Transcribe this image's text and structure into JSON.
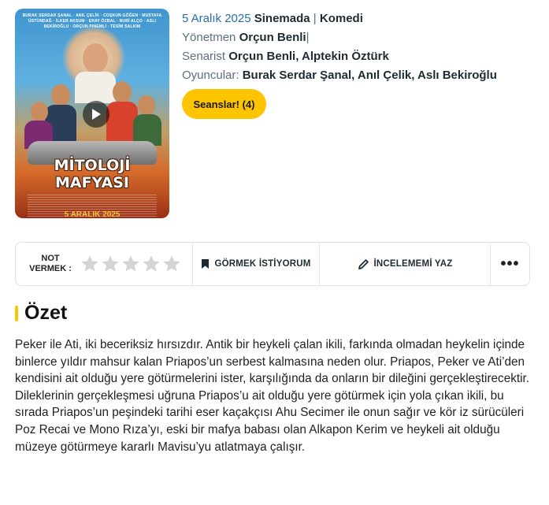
{
  "poster": {
    "cast_line": "BURAK SERDAR ŞANAL · ANIL ÇELİK · COŞKUN GÖĞEN · MUSTAFA ÜSTÜNDAĞ · İLKER AKSUM · ERAY ÖZBAL · NURİ ALÇO · ASLI BEKİROĞLU · ORÇUN PINEMLİ · TESİM SALKIM",
    "title_line1": "MİTOLOJİ",
    "title_line2": "MAFYASI",
    "date": "5 ARALIK 2025"
  },
  "meta": {
    "date": "5 Aralık 2025",
    "release": "Sinemada",
    "separator": "|",
    "genre": "Komedi",
    "director_label": "Yönetmen",
    "director": "Orçun Benli",
    "director_sep": "|",
    "writer_label": "Senarist",
    "writers": "Orçun Benli, Alptekin Öztürk",
    "cast_label": "Oyuncular:",
    "cast": "Burak Serdar Şanal, Anıl Çelik, Aslı Bekiroğlu"
  },
  "showtimes_button": "Seanslar! (4)",
  "actionbar": {
    "rate_label_line1": "NOT",
    "rate_label_line2": "VERMEK :",
    "star_count": 5,
    "rating_value": 0,
    "watchlist_label": "GÖRMEK İSTİYORUM",
    "review_label": "İNCELEMEMİ YAZ",
    "more_label": "•••"
  },
  "summary": {
    "title": "Özet",
    "text": "Peker ile Ati, iki beceriksiz hırsızdır. Antik bir heykeli çalan ikili, farkında olmadan heykelin içinde binlerce yıldır mahsur kalan Priapos’un serbest kalmasına neden olur. Priapos, Peker ve Ati’den kendisini ait olduğu yere götürmelerini ister, karşılığında da onların bir dileğini gerçekleştirecektir. Dileklerinin gerçekleşmesi uğruna Priapos’u ait olduğu yere götürmek için yola çıkan ikili, bu sırada Priapos’un peşindeki tarihi eser kaçakçısı Ahu Secimer ile onun sağır ve kör iz sürücüleri Poz Recai ve Mono Rıza’yı, eski bir mafya babası olan Alkapon Kerim ve heykeli ait olduğu müzeye götürmeye kararlı Mavisu’yu atlatmaya çalışır."
  },
  "colors": {
    "accent": "#ffc400",
    "link_blue": "#2a6fa8",
    "muted": "#5e6f7e",
    "star_empty": "#d4d4d4"
  }
}
